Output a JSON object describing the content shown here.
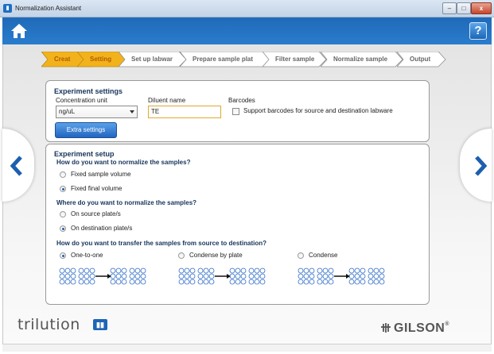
{
  "window": {
    "title": "Normalization Assistant",
    "minimize": "–",
    "maximize": "□",
    "close": "x"
  },
  "header": {
    "help_label": "?",
    "home_icon": "home-icon"
  },
  "wizard": {
    "steps": [
      {
        "label": "Creat",
        "active": true
      },
      {
        "label": "Setting",
        "active": true
      },
      {
        "label": "Set up labwar",
        "active": false
      },
      {
        "label": "Prepare sample plat",
        "active": false
      },
      {
        "label": "Filter sample",
        "active": false
      },
      {
        "label": "Normalize sample",
        "active": false
      },
      {
        "label": "Output",
        "active": false
      }
    ]
  },
  "experiment_settings": {
    "title": "Experiment settings",
    "concentration_unit_label": "Concentration unit",
    "concentration_unit_value": "ng/uL",
    "diluent_name_label": "Diluent name",
    "diluent_name_value": "TE",
    "barcodes_label": "Barcodes",
    "barcodes_checkbox_label": "Support barcodes for source and destination labware",
    "barcodes_checked": false,
    "extra_settings_button": "Extra settings"
  },
  "experiment_setup": {
    "title": "Experiment setup",
    "q_normalize": "How do you want to normalize the samples?",
    "normalize_options": [
      "Fixed sample volume",
      "Fixed final volume"
    ],
    "normalize_selected": 1,
    "q_where": "Where do you want to normalize the samples?",
    "where_options": [
      "On source plate/s",
      "On destination plate/s"
    ],
    "where_selected": 1,
    "q_transfer": "How do you want to transfer the samples from source to destination?",
    "transfer_options": [
      "One-to-one",
      "Condense by plate",
      "Condense"
    ],
    "transfer_selected": 0
  },
  "footer": {
    "brand_left": "trilution",
    "brand_right": "GILSON",
    "reg_mark": "®"
  },
  "colors": {
    "header_blue": "#1f6ab8",
    "active_step": "#f2b21c",
    "title_navy": "#16345b",
    "nav_arrow": "#1d5fae"
  }
}
